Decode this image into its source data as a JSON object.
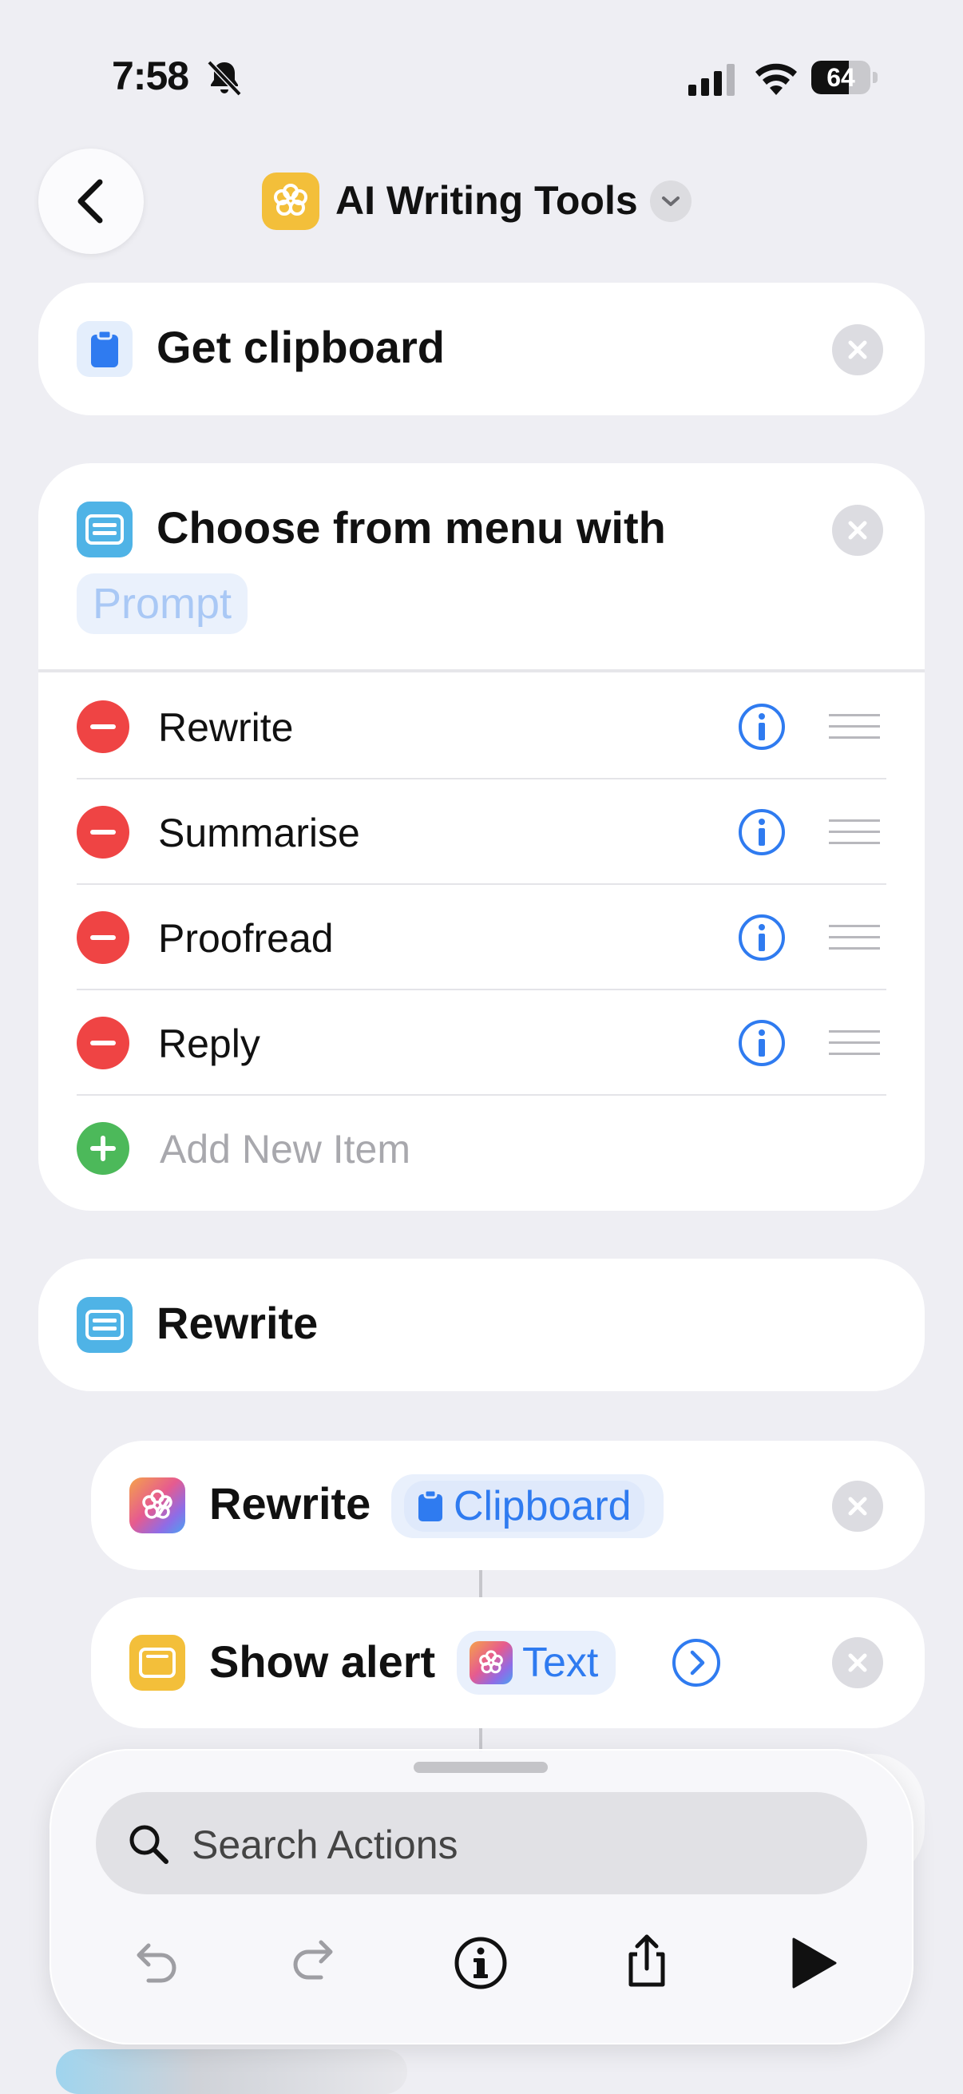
{
  "status_bar": {
    "time": "7:58",
    "battery": "64",
    "battery_level": 0.64
  },
  "header": {
    "title": "AI Writing Tools"
  },
  "actions": {
    "get_clipboard": {
      "title": "Get clipboard"
    },
    "choose_menu": {
      "title": "Choose from menu with",
      "prompt_placeholder": "Prompt",
      "items": [
        "Rewrite",
        "Summarise",
        "Proofread",
        "Reply"
      ],
      "add_item": "Add New Item"
    },
    "rewrite_case": {
      "title": "Rewrite"
    },
    "rewrite_action": {
      "title": "Rewrite",
      "input": "Clipboard"
    },
    "show_alert": {
      "title": "Show alert",
      "input": "Text"
    }
  },
  "sheet": {
    "search_placeholder": "Search Actions"
  },
  "colors": {
    "accent": "#2f7bf0",
    "destructive": "#ef4444",
    "add": "#4cb95a",
    "title_icon": "#f3bf3a"
  }
}
